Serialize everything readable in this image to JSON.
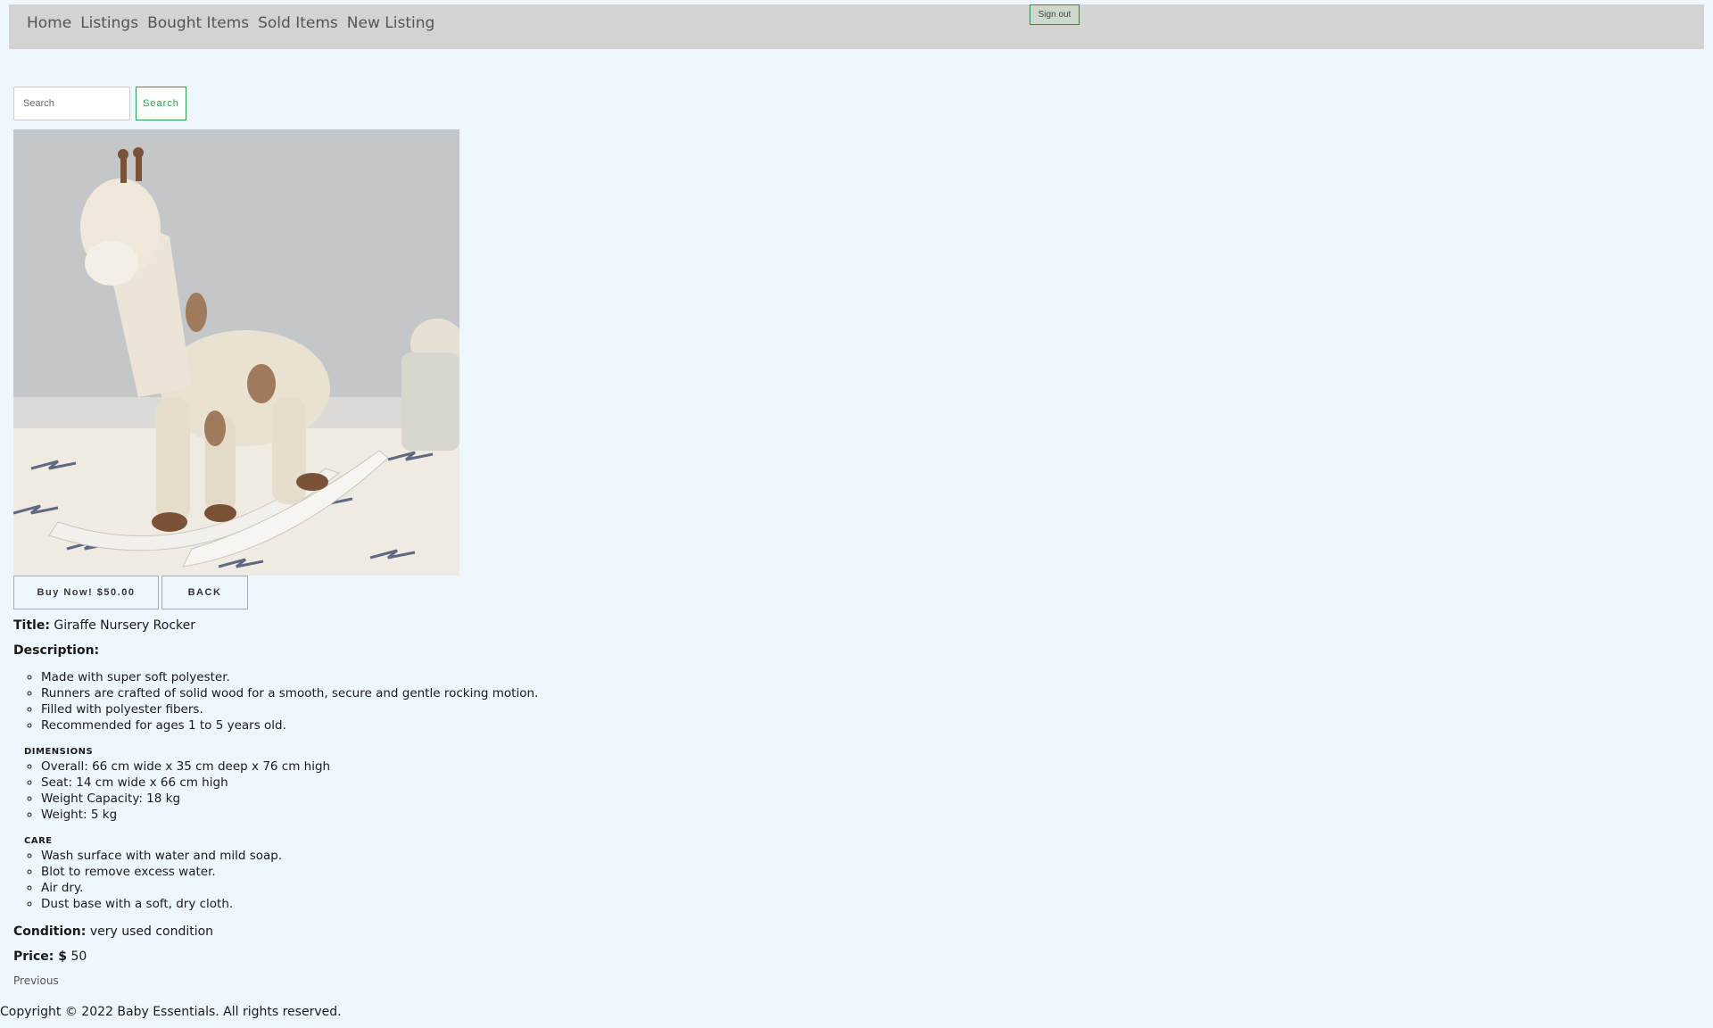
{
  "nav": {
    "items": [
      "Home",
      "Listings",
      "Bought Items",
      "Sold Items",
      "New Listing"
    ],
    "signout": "Sign out"
  },
  "search": {
    "placeholder": "Search",
    "button": "Search"
  },
  "product": {
    "buy_label": "Buy Now! $50.00",
    "back_label": "BACK",
    "title_label": "Title:",
    "title": "Giraffe Nursery Rocker",
    "description_label": "Description:",
    "features": [
      "Made with super soft polyester.",
      "Runners are crafted of solid wood for a smooth, secure and gentle rocking motion.",
      "Filled with polyester fibers.",
      "Recommended for ages 1 to 5 years old."
    ],
    "dimensions_heading": "DIMENSIONS",
    "dimensions": [
      "Overall: 66 cm wide x 35 cm deep x 76 cm high",
      "Seat: 14 cm wide x 66 cm high",
      "Weight Capacity: 18 kg",
      "Weight: 5 kg"
    ],
    "care_heading": "CARE",
    "care": [
      "Wash surface with water and mild soap.",
      "Blot to remove excess water.",
      "Air dry.",
      "Dust base with a soft, dry cloth."
    ],
    "condition_label": "Condition:",
    "condition": "very used condition",
    "price_label": "Price: $",
    "price": "50"
  },
  "pagination": {
    "previous": "Previous"
  },
  "footer": {
    "copyright": "Copyright © 2022 Baby Essentials. All rights reserved."
  }
}
